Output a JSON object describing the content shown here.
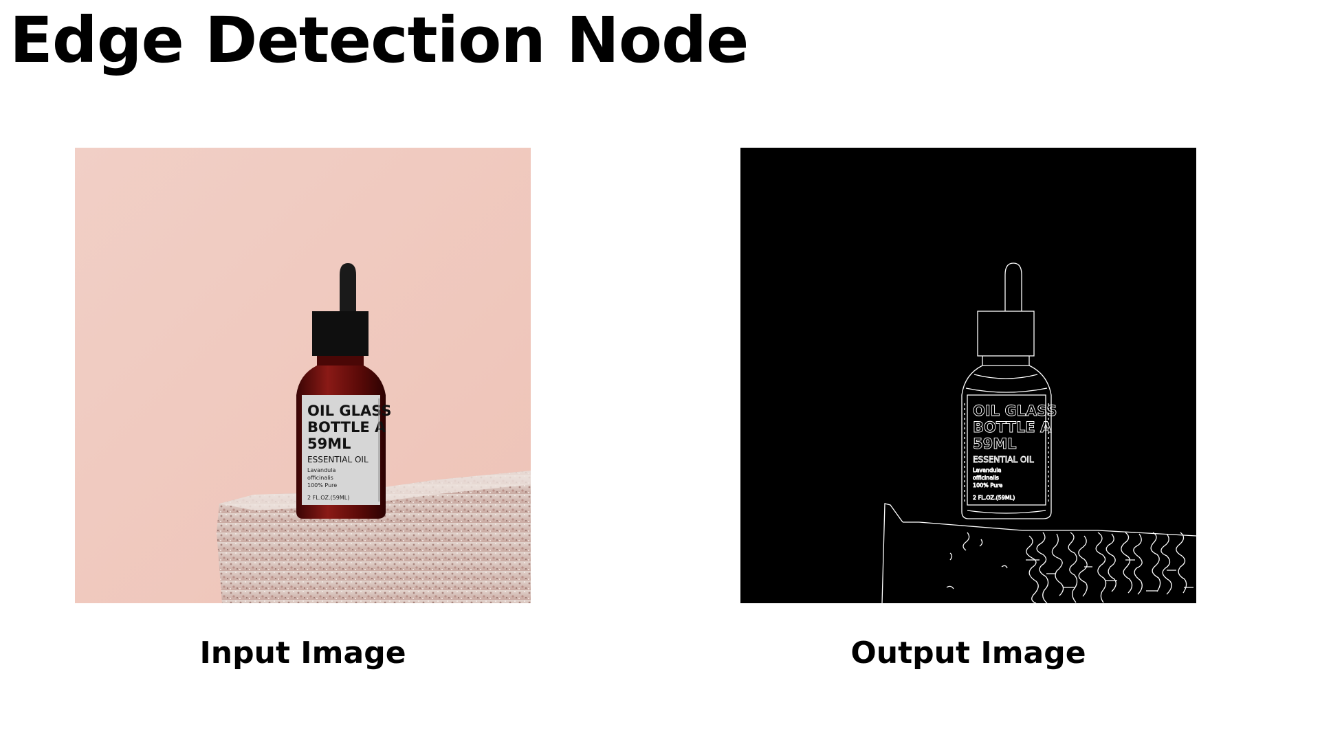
{
  "page": {
    "title": "Edge Detection Node"
  },
  "input_panel": {
    "caption": "Input Image",
    "image": {
      "label_line1": "OIL GLASS",
      "label_line2": "BOTTLE A",
      "label_line3": "59ML",
      "label_type": "ESSENTIAL OIL",
      "label_species1": "Lavandula",
      "label_species2": "officinalis",
      "label_purity": "100% Pure",
      "label_volume": "2 FL.OZ.(59ML)"
    }
  },
  "output_panel": {
    "caption": "Output Image",
    "image": {
      "label_line1": "OIL GLASS",
      "label_line2": "BOTTLE A",
      "label_line3": "59ML",
      "label_type": "ESSENTIAL OIL",
      "label_species1": "Lavandula",
      "label_species2": "officinalis",
      "label_purity": "100% Pure",
      "label_volume": "2 FL.OZ.(59ML)"
    }
  },
  "colors": {
    "background": "#ffffff",
    "text": "#000000",
    "wall_pink": "#efc7bd",
    "stone": "#d7c0b8",
    "bottle_amber": "#6d0f0f",
    "bottle_cap": "#111111",
    "label_paper": "#d6d6d6",
    "edge_line": "#ffffff",
    "edge_background": "#000000"
  }
}
